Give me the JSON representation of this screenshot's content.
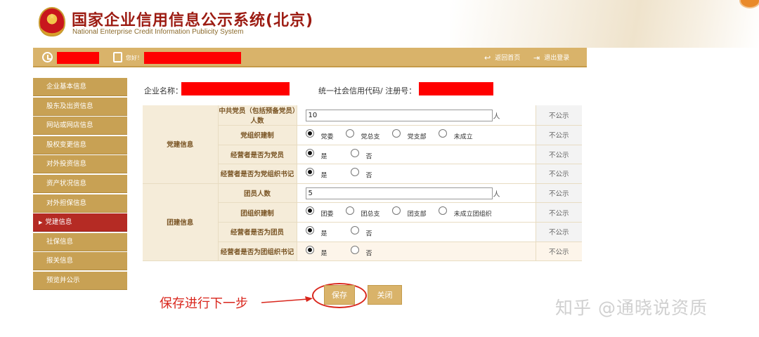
{
  "header": {
    "title": "国家企业信用信息公示系统(北京)",
    "subtitle": "National Enterprise Credit Information Publicity System"
  },
  "topbar": {
    "greeting": "您好！",
    "home_link": "返回首页",
    "logout_link": "退出登录"
  },
  "sidebar": {
    "items": [
      {
        "label": "企业基本信息",
        "active": false
      },
      {
        "label": "股东及出资信息",
        "active": false
      },
      {
        "label": "网站或网店信息",
        "active": false
      },
      {
        "label": "股权变更信息",
        "active": false
      },
      {
        "label": "对外投资信息",
        "active": false
      },
      {
        "label": "资产状况信息",
        "active": false
      },
      {
        "label": "对外担保信息",
        "active": false
      },
      {
        "label": "党建信息",
        "active": true
      },
      {
        "label": "社保信息",
        "active": false
      },
      {
        "label": "报关信息",
        "active": false
      },
      {
        "label": "预览并公示",
        "active": false
      }
    ]
  },
  "company": {
    "name_label": "企业名称：",
    "code_label": "统一社会信用代码/ 注册号："
  },
  "form": {
    "party_group": "党建信息",
    "league_group": "团建信息",
    "status_text": "不公示",
    "party_members": {
      "label": "中共党员（包括预备党员）人数",
      "value": "10",
      "unit": "人"
    },
    "party_org": {
      "label": "党组织建制",
      "options": [
        "党委",
        "党总支",
        "党支部",
        "未成立"
      ],
      "selected": 0
    },
    "operator_party": {
      "label": "经营者是否为党员",
      "options": [
        "是",
        "否"
      ],
      "selected": 0
    },
    "operator_secretary": {
      "label": "经营者是否为党组织书记",
      "options": [
        "是",
        "否"
      ],
      "selected": 0
    },
    "league_members": {
      "label": "团员人数",
      "value": "5",
      "unit": "人"
    },
    "league_org": {
      "label": "团组织建制",
      "options": [
        "团委",
        "团总支",
        "团支部",
        "未成立团组织"
      ],
      "selected": 0
    },
    "operator_league": {
      "label": "经营者是否为团员",
      "options": [
        "是",
        "否"
      ],
      "selected": 0
    },
    "operator_league_secretary": {
      "label": "经营者是否为团组织书记",
      "options": [
        "是",
        "否"
      ],
      "selected": 0
    }
  },
  "actions": {
    "save": "保存",
    "close": "关闭"
  },
  "annotation": "保存进行下一步",
  "watermark": "知乎 @通晓说资质",
  "colors": {
    "gold": "#d9b36a",
    "active_red": "#b52b24",
    "redaction": "#ff0000",
    "annotation_red": "#d9261c"
  }
}
